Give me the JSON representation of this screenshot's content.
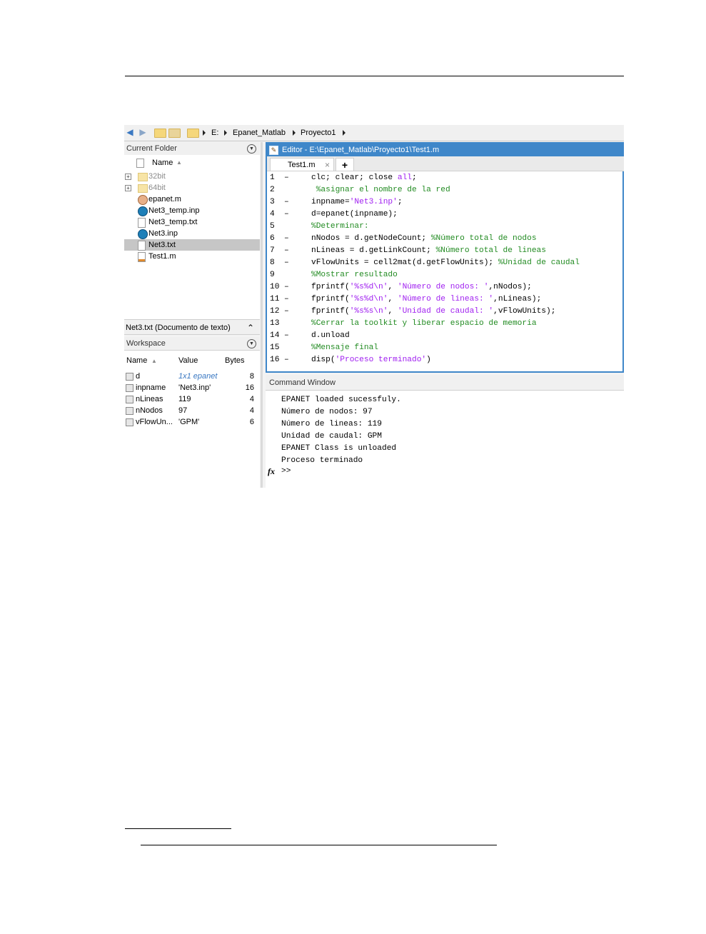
{
  "address_bar": {
    "path": [
      "E:",
      "Epanet_Matlab",
      "Proyecto1"
    ]
  },
  "current_folder": {
    "title": "Current Folder",
    "column_name": "Name",
    "items": [
      {
        "name": "32bit",
        "type": "folder",
        "expandable": true,
        "selected": false
      },
      {
        "name": "64bit",
        "type": "folder",
        "expandable": true,
        "selected": false
      },
      {
        "name": "epanet.m",
        "type": "class-file",
        "expandable": false,
        "selected": false
      },
      {
        "name": "Net3_temp.inp",
        "type": "epanet-file",
        "expandable": false,
        "selected": false
      },
      {
        "name": "Net3_temp.txt",
        "type": "text-file",
        "expandable": false,
        "selected": false
      },
      {
        "name": "Net3.inp",
        "type": "epanet-file",
        "expandable": false,
        "selected": false
      },
      {
        "name": "Net3.txt",
        "type": "text-file",
        "expandable": false,
        "selected": true
      },
      {
        "name": "Test1.m",
        "type": "script-file",
        "expandable": false,
        "selected": false
      }
    ],
    "details": "Net3.txt  (Documento de texto)"
  },
  "workspace": {
    "title": "Workspace",
    "columns": [
      "Name",
      "Value",
      "Bytes"
    ],
    "rows": [
      {
        "name": "d",
        "value": "1x1 epanet",
        "bytes": "8",
        "italic": true
      },
      {
        "name": "inpname",
        "value": "'Net3.inp'",
        "bytes": "16",
        "italic": false
      },
      {
        "name": "nLineas",
        "value": "119",
        "bytes": "4",
        "italic": false
      },
      {
        "name": "nNodos",
        "value": "97",
        "bytes": "4",
        "italic": false
      },
      {
        "name": "vFlowUn...",
        "value": "'GPM'",
        "bytes": "6",
        "italic": false
      }
    ]
  },
  "editor": {
    "title": "Editor - E:\\Epanet_Matlab\\Proyecto1\\Test1.m",
    "tab": "Test1.m",
    "add_tab": "+",
    "lines": [
      {
        "n": "1",
        "dash": true,
        "parts": [
          {
            "t": "clc; clear; close ",
            "c": ""
          },
          {
            "t": "all",
            "c": "kw"
          },
          {
            "t": ";",
            "c": ""
          }
        ]
      },
      {
        "n": "2",
        "dash": false,
        "parts": [
          {
            "t": " %asignar el nombre de la red",
            "c": "cm"
          }
        ]
      },
      {
        "n": "3",
        "dash": true,
        "parts": [
          {
            "t": "inpname=",
            "c": ""
          },
          {
            "t": "'Net3.inp'",
            "c": "kw"
          },
          {
            "t": ";",
            "c": ""
          }
        ]
      },
      {
        "n": "4",
        "dash": true,
        "parts": [
          {
            "t": "d=epanet(inpname);",
            "c": ""
          }
        ]
      },
      {
        "n": "5",
        "dash": false,
        "parts": [
          {
            "t": "%Determinar:",
            "c": "cm"
          }
        ]
      },
      {
        "n": "6",
        "dash": true,
        "parts": [
          {
            "t": "nNodos = d.getNodeCount; ",
            "c": ""
          },
          {
            "t": "%Número total de nodos",
            "c": "cm"
          }
        ]
      },
      {
        "n": "7",
        "dash": true,
        "parts": [
          {
            "t": "nLineas = d.getLinkCount; ",
            "c": ""
          },
          {
            "t": "%Número total de lineas",
            "c": "cm"
          }
        ]
      },
      {
        "n": "8",
        "dash": true,
        "parts": [
          {
            "t": "vFlowUnits = cell2mat(d.getFlowUnits); ",
            "c": ""
          },
          {
            "t": "%Unidad de caudal",
            "c": "cm"
          }
        ]
      },
      {
        "n": "9",
        "dash": false,
        "parts": [
          {
            "t": "%Mostrar resultado",
            "c": "cm"
          }
        ]
      },
      {
        "n": "10",
        "dash": true,
        "parts": [
          {
            "t": "fprintf(",
            "c": ""
          },
          {
            "t": "'%s%d\\n'",
            "c": "kw"
          },
          {
            "t": ", ",
            "c": ""
          },
          {
            "t": "'Número de nodos: '",
            "c": "kw"
          },
          {
            "t": ",nNodos);",
            "c": ""
          }
        ]
      },
      {
        "n": "11",
        "dash": true,
        "parts": [
          {
            "t": "fprintf(",
            "c": ""
          },
          {
            "t": "'%s%d\\n'",
            "c": "kw"
          },
          {
            "t": ", ",
            "c": ""
          },
          {
            "t": "'Número de lineas: '",
            "c": "kw"
          },
          {
            "t": ",nLineas);",
            "c": ""
          }
        ]
      },
      {
        "n": "12",
        "dash": true,
        "parts": [
          {
            "t": "fprintf(",
            "c": ""
          },
          {
            "t": "'%s%s\\n'",
            "c": "kw"
          },
          {
            "t": ", ",
            "c": ""
          },
          {
            "t": "'Unidad de caudal: '",
            "c": "kw"
          },
          {
            "t": ",vFlowUnits);",
            "c": ""
          }
        ]
      },
      {
        "n": "13",
        "dash": false,
        "parts": [
          {
            "t": "%Cerrar la toolkit y liberar espacio de memoria",
            "c": "cm"
          }
        ]
      },
      {
        "n": "14",
        "dash": true,
        "parts": [
          {
            "t": "d.unload",
            "c": ""
          }
        ]
      },
      {
        "n": "15",
        "dash": false,
        "parts": [
          {
            "t": "%Mensaje final",
            "c": "cm"
          }
        ]
      },
      {
        "n": "16",
        "dash": true,
        "parts": [
          {
            "t": "disp(",
            "c": ""
          },
          {
            "t": "'Proceso terminado'",
            "c": "kw"
          },
          {
            "t": ")",
            "c": ""
          }
        ]
      }
    ]
  },
  "command_window": {
    "title": "Command Window",
    "output": [
      "EPANET loaded sucessfuly.",
      "Número de nodos: 97",
      "Número de lineas: 119",
      "Unidad de caudal: GPM",
      "EPANET Class is unloaded",
      "Proceso terminado"
    ],
    "fx": "fx",
    "prompt": ">>"
  },
  "colors": {
    "editor_accent": "#3f87c9",
    "string_purple": "#a020f0",
    "comment_green": "#228b22",
    "selection_gray": "#c6c6c6"
  }
}
